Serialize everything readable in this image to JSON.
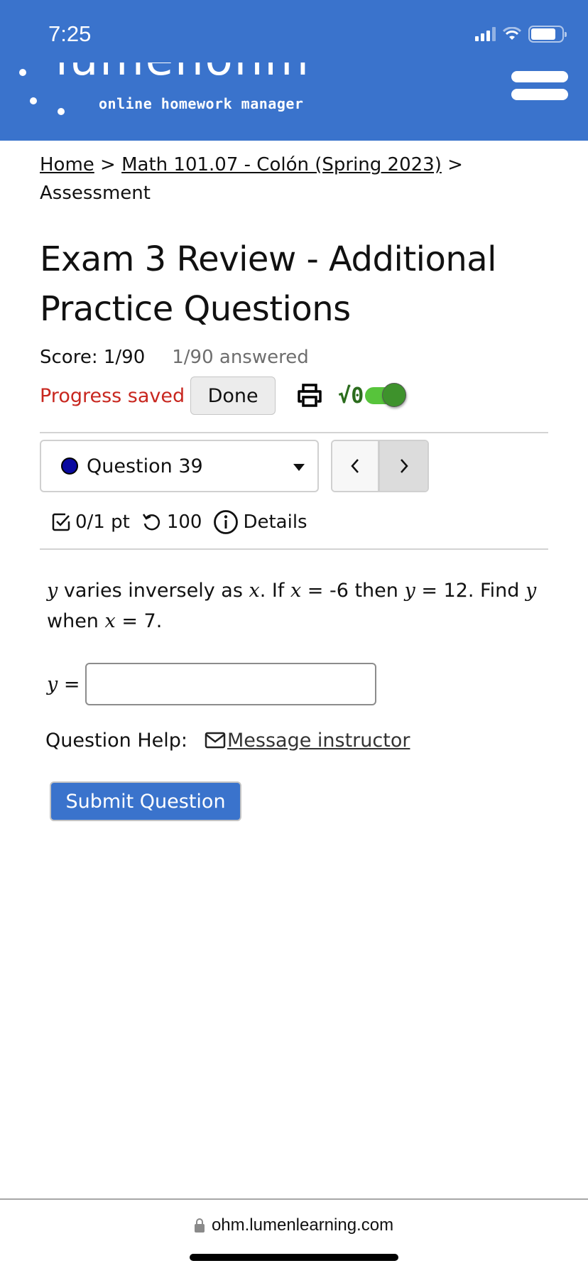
{
  "status_bar": {
    "time": "7:25",
    "icons": [
      "cellular-signal-icon",
      "wifi-icon",
      "battery-icon"
    ]
  },
  "header": {
    "logo_word": "lumenohm",
    "logo_tagline": "online homework manager",
    "menu_icon": "hamburger-menu-icon",
    "background_color": "#3a73cc"
  },
  "breadcrumb": {
    "items": [
      {
        "label": "Home",
        "link": true
      },
      {
        "label": "Math 101.07 - Colón (Spring 2023)",
        "link": true
      },
      {
        "label": "Assessment",
        "link": false
      }
    ],
    "separator": ">"
  },
  "page": {
    "title": "Exam 3 Review - Additional Practice Questions",
    "score": "Score: 1/90",
    "answered": "1/90 answered",
    "progress_status": "Progress saved",
    "progress_status_color": "#c8271f",
    "done_label": "Done",
    "print_icon": "printer-icon",
    "math_toggle_label": "√0",
    "math_toggle_on": true
  },
  "question_nav": {
    "selected": "Question 39",
    "status_dot_color": "#0a0aa0",
    "prev_label": "<",
    "next_label": ">"
  },
  "question_meta": {
    "points": "0/1 pt",
    "attempts": "100",
    "details_label": "Details"
  },
  "question": {
    "text_parts": [
      {
        "math": "y"
      },
      {
        "text": " varies inversely as "
      },
      {
        "math": "x"
      },
      {
        "text": ". If "
      },
      {
        "math": "x"
      },
      {
        "text": " = -6 then "
      },
      {
        "math": "y"
      },
      {
        "text": " = 12. Find "
      },
      {
        "math": "y"
      },
      {
        "text": " when "
      },
      {
        "math": "x"
      },
      {
        "text": " = 7."
      }
    ],
    "answer_label_var": "y",
    "answer_label_eq": "=",
    "answer_value": "",
    "answer_placeholder": "",
    "help_label": "Question Help:",
    "help_link": "Message instructor",
    "submit_label": "Submit Question"
  },
  "browser": {
    "url": "ohm.lumenlearning.com"
  }
}
